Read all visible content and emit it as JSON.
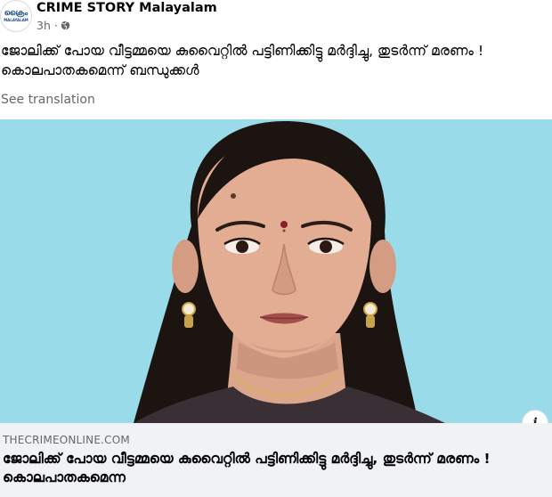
{
  "post": {
    "page_name": "CRIME STORY Malayalam",
    "time": "3h ·",
    "avatar_logo": "ക്രൈം",
    "avatar_sub": "MALAYALAM",
    "text": "ജോലിക്ക് പോയ വീട്ടമ്മയെ കുവൈറ്റിൽ പട്ടിണിക്കിട്ടു മർദ്ദിച്ചു, തുടർന്ന് മരണം ! കൊലപാതകമെന്ന് ബന്ധുക്കൾ",
    "see_translation": "See translation"
  },
  "link_card": {
    "domain": "THECRIMEONLINE.COM",
    "title": "ജോലിക്ക് പോയ വീട്ടമ്മയെ കുവൈറ്റിൽ പട്ടിണിക്കിട്ടു മർദ്ദിച്ചു, തുടർന്ന് മരണം ! കൊലപാതകമെന്ന",
    "info_glyph": "i"
  },
  "icons": {
    "globe": "globe-icon",
    "info": "info-icon"
  },
  "colors": {
    "photo_background": "#9adbe9",
    "secondary_text": "#65676b",
    "card_footer": "#f0f2f5"
  }
}
